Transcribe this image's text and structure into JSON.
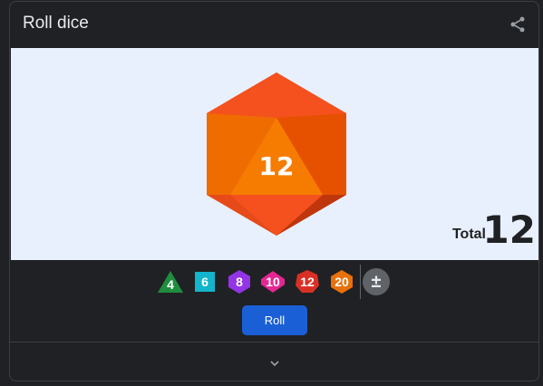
{
  "widget": {
    "title": "Roll dice"
  },
  "die": {
    "sides": 20,
    "value": "12",
    "colors": {
      "light": "#f57c00",
      "base": "#ef6c00",
      "dark": "#d84315",
      "top": "#ff5722"
    }
  },
  "total": {
    "label": "Total",
    "value": "12"
  },
  "dice_buttons": [
    {
      "label": "4",
      "color": "#1e8e3e",
      "shape": "triangle"
    },
    {
      "label": "6",
      "color": "#12b5cb",
      "shape": "square"
    },
    {
      "label": "8",
      "color": "#9334e6",
      "shape": "hexagon"
    },
    {
      "label": "10",
      "color": "#e52592",
      "shape": "diamond-hex"
    },
    {
      "label": "12",
      "color": "#d93025",
      "shape": "hexagon"
    },
    {
      "label": "20",
      "color": "#e8710a",
      "shape": "hexagon"
    }
  ],
  "modifier": {
    "label": "±"
  },
  "roll_button": {
    "label": "Roll"
  },
  "icons": {
    "share": "share-icon",
    "expand": "chevron-down-icon"
  }
}
